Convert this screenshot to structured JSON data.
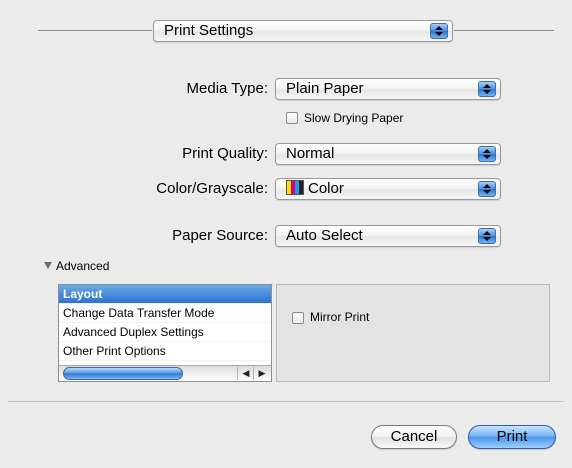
{
  "header": {
    "section_select": "Print Settings"
  },
  "form": {
    "media_type": {
      "label": "Media Type:",
      "value": "Plain Paper"
    },
    "slow_drying": {
      "label": "Slow Drying Paper",
      "checked": false
    },
    "print_quality": {
      "label": "Print Quality:",
      "value": "Normal"
    },
    "color_grayscale": {
      "label": "Color/Grayscale:",
      "value": "Color"
    },
    "paper_source": {
      "label": "Paper Source:",
      "value": "Auto Select"
    }
  },
  "advanced": {
    "label": "Advanced",
    "list": [
      {
        "label": "Layout",
        "selected": true
      },
      {
        "label": "Change Data Transfer Mode",
        "selected": false
      },
      {
        "label": "Advanced Duplex Settings",
        "selected": false
      },
      {
        "label": "Other Print Options",
        "selected": false
      }
    ],
    "mirror_print": {
      "label": "Mirror Print",
      "checked": false
    }
  },
  "buttons": {
    "cancel": "Cancel",
    "print": "Print"
  },
  "colors": {
    "panel": "#ebebeb",
    "accent": "#3f8ae6"
  }
}
